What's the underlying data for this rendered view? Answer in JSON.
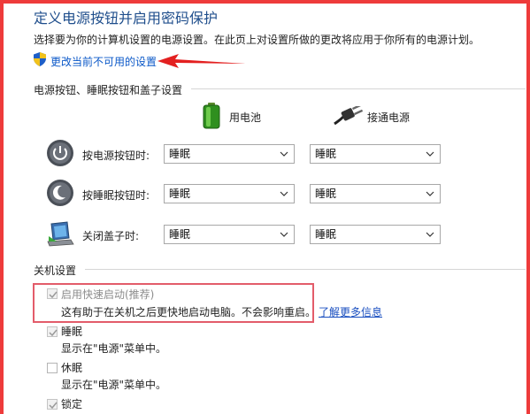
{
  "page": {
    "title": "定义电源按钮并启用密码保护",
    "description": "选择要为你的计算机设置的电源设置。在此页上对设置所做的更改将应用于你所有的电源计划。",
    "change_link": "更改当前不可用的设置"
  },
  "power_section": {
    "title": "电源按钮、睡眠按钮和盖子设置",
    "columns": {
      "battery": "用电池",
      "plugged": "接通电源"
    },
    "rows": [
      {
        "label": "按电源按钮时:",
        "battery": "睡眠",
        "plugged": "睡眠",
        "icon": "power-button-icon"
      },
      {
        "label": "按睡眠按钮时:",
        "battery": "睡眠",
        "plugged": "睡眠",
        "icon": "sleep-button-icon"
      },
      {
        "label": "关闭盖子时:",
        "battery": "睡眠",
        "plugged": "睡眠",
        "icon": "laptop-lid-icon"
      }
    ]
  },
  "shutdown_section": {
    "title": "关机设置",
    "fast_startup": {
      "label": "启用快速启动(推荐)",
      "checked": true,
      "description": "这有助于在关机之后更快地启动电脑。不会影响重启。",
      "link": "了解更多信息"
    },
    "sleep": {
      "label": "睡眠",
      "checked": true,
      "description": "显示在\"电源\"菜单中。"
    },
    "hibernate": {
      "label": "休眠",
      "checked": false,
      "description": "显示在\"电源\"菜单中。"
    },
    "lock": {
      "label": "锁定",
      "checked": true
    }
  },
  "colors": {
    "accent_red": "#ee3b3b",
    "link_blue": "#0b58c8",
    "title_blue": "#1f4e8c"
  }
}
